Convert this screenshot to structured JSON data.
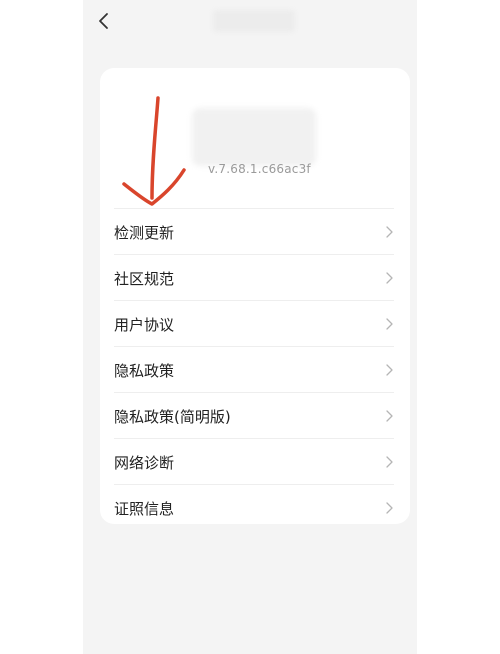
{
  "header": {
    "back_icon": "chevron-left-icon"
  },
  "about": {
    "version": "v.7.68.1.c66ac3f"
  },
  "menu": {
    "items": [
      {
        "label": "检测更新",
        "icon": "chevron-right-icon"
      },
      {
        "label": "社区规范",
        "icon": "chevron-right-icon"
      },
      {
        "label": "用户协议",
        "icon": "chevron-right-icon"
      },
      {
        "label": "隐私政策",
        "icon": "chevron-right-icon"
      },
      {
        "label": "隐私政策(简明版)",
        "icon": "chevron-right-icon"
      },
      {
        "label": "网络诊断",
        "icon": "chevron-right-icon"
      },
      {
        "label": "证照信息",
        "icon": "chevron-right-icon"
      }
    ]
  },
  "colors": {
    "annotation": "#d9452c",
    "background": "#f4f4f4",
    "card": "#ffffff"
  }
}
